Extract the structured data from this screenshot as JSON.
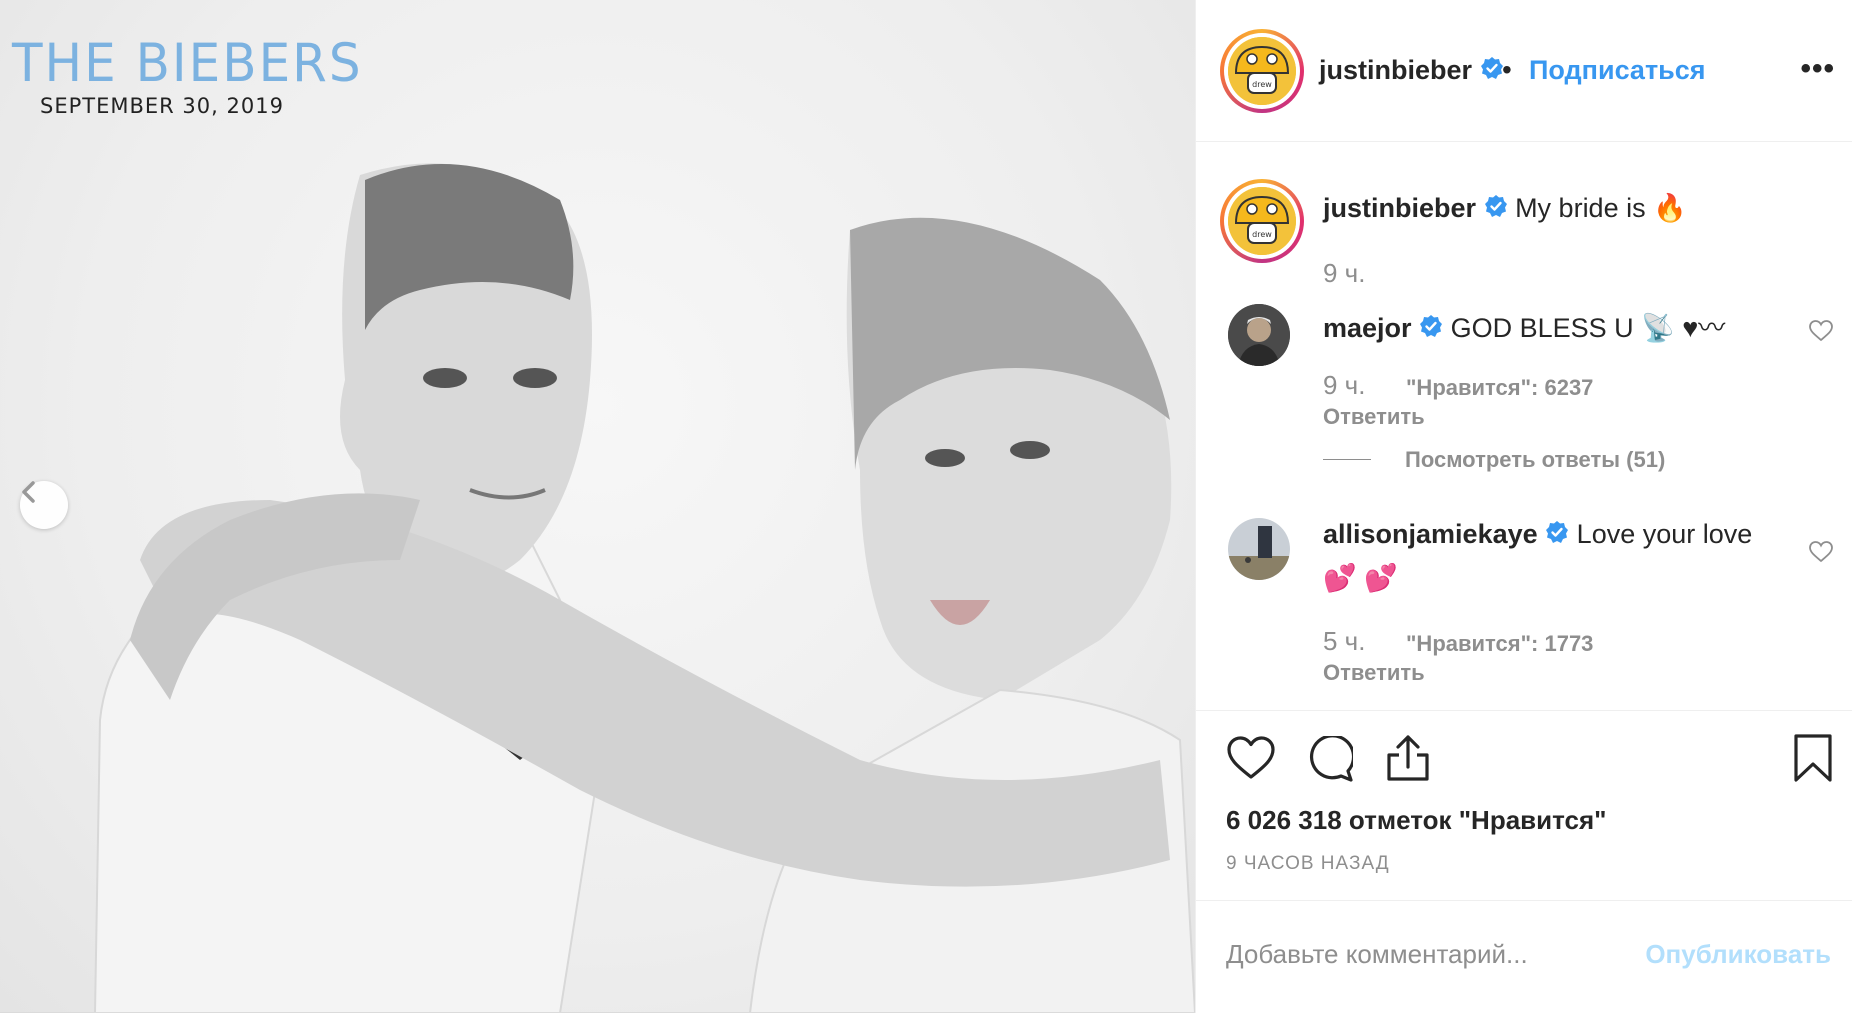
{
  "photo": {
    "title": "THE BIEBERS",
    "date": "SEPTEMBER 30, 2019"
  },
  "header": {
    "username": "justinbieber",
    "separator": "•",
    "follow_label": "Подписаться",
    "more_label": "•••"
  },
  "caption": {
    "username": "justinbieber",
    "text": "My bride is 🔥",
    "time": "9 ч."
  },
  "comments": [
    {
      "username": "maejor",
      "text": "GOD BLESS U 📡 ♥〰",
      "time": "9 ч.",
      "likes": "\"Нравится\": 6237",
      "reply_label": "Ответить",
      "view_replies": "Посмотреть ответы (51)"
    },
    {
      "username": "allisonjamiekaye",
      "text_line1": "Love your love",
      "text_line2": "💕 💕",
      "time": "5 ч.",
      "likes": "\"Нравится\": 1773",
      "reply_label": "Ответить"
    }
  ],
  "actions": {
    "likes_count": "6 026 318 отметок \"Нравится\"",
    "posted_ago": "9 ЧАСОВ НАЗАД"
  },
  "add_comment": {
    "placeholder": "Добавьте комментарий...",
    "publish_label": "Опубликовать"
  },
  "colors": {
    "link_blue": "#3897f0",
    "publish_disabled": "#b2dffc",
    "verified_blue": "#3897f0",
    "muted_text": "#8e8e8e"
  },
  "icons": [
    "chevron-left-icon",
    "verified-badge-icon",
    "more-icon",
    "heart-icon",
    "comment-icon",
    "share-icon",
    "bookmark-icon"
  ]
}
